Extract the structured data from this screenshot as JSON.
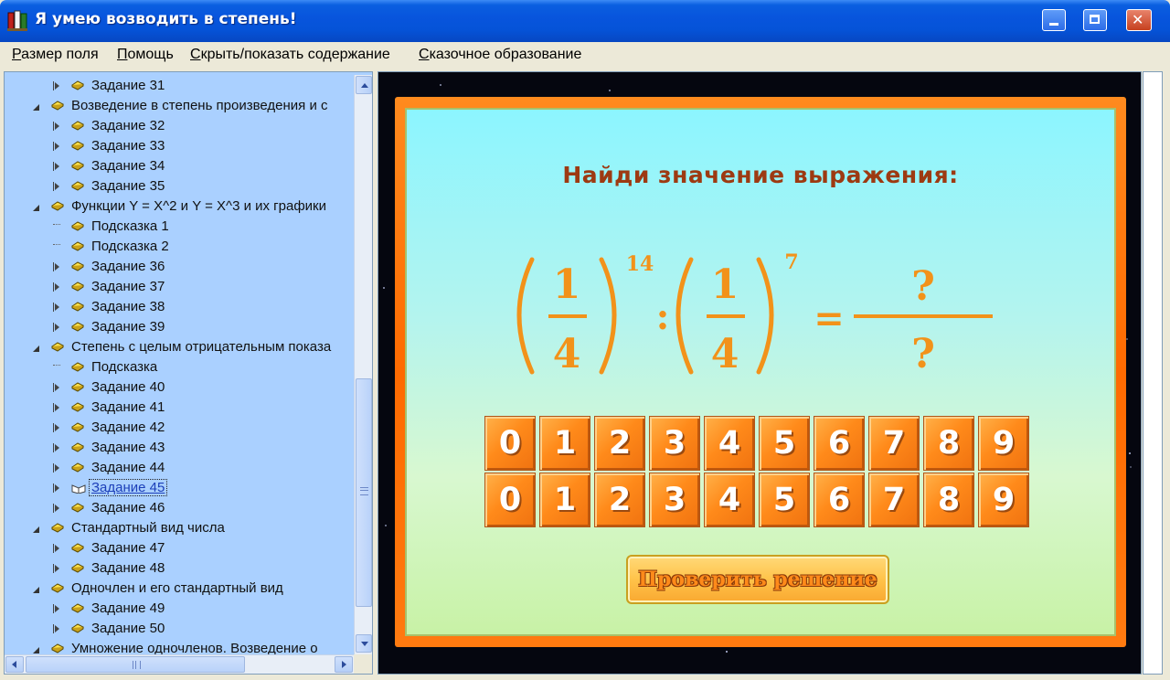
{
  "window": {
    "title": "Я умею возводить в степень!"
  },
  "menu": [
    {
      "before": "",
      "underline": "Р",
      "after": "азмер поля"
    },
    {
      "before": "",
      "underline": "П",
      "after": "омощь"
    },
    {
      "before": "",
      "underline": "С",
      "after": "крыть/показать содержание"
    },
    {
      "before": "",
      "underline": "С",
      "after": "казочное образование"
    }
  ],
  "tree": [
    {
      "level": 2,
      "expander": "closed",
      "label": "Задание 31"
    },
    {
      "level": 1,
      "expander": "open",
      "label": "Возведение в степень произведения и с"
    },
    {
      "level": 2,
      "expander": "closed",
      "label": "Задание 32"
    },
    {
      "level": 2,
      "expander": "closed",
      "label": "Задание 33"
    },
    {
      "level": 2,
      "expander": "closed",
      "label": "Задание 34"
    },
    {
      "level": 2,
      "expander": "closed",
      "label": "Задание 35"
    },
    {
      "level": 1,
      "expander": "open",
      "label": "Функции Y = X^2 и Y = X^3 и их графики"
    },
    {
      "level": 2,
      "expander": "none",
      "label": "Подсказка 1"
    },
    {
      "level": 2,
      "expander": "none",
      "label": "Подсказка 2"
    },
    {
      "level": 2,
      "expander": "closed",
      "label": "Задание 36"
    },
    {
      "level": 2,
      "expander": "closed",
      "label": "Задание 37"
    },
    {
      "level": 2,
      "expander": "closed",
      "label": "Задание 38"
    },
    {
      "level": 2,
      "expander": "closed",
      "label": "Задание 39"
    },
    {
      "level": 1,
      "expander": "open",
      "label": "Степень с целым отрицательным показа"
    },
    {
      "level": 2,
      "expander": "none",
      "label": "Подсказка"
    },
    {
      "level": 2,
      "expander": "closed",
      "label": "Задание 40"
    },
    {
      "level": 2,
      "expander": "closed",
      "label": "Задание 41"
    },
    {
      "level": 2,
      "expander": "closed",
      "label": "Задание 42"
    },
    {
      "level": 2,
      "expander": "closed",
      "label": "Задание 43"
    },
    {
      "level": 2,
      "expander": "closed",
      "label": "Задание 44"
    },
    {
      "level": 2,
      "expander": "closed",
      "label": "Задание 45",
      "selected": true
    },
    {
      "level": 2,
      "expander": "closed",
      "label": "Задание 46"
    },
    {
      "level": 1,
      "expander": "open",
      "label": "Стандартный вид числа"
    },
    {
      "level": 2,
      "expander": "closed",
      "label": "Задание 47"
    },
    {
      "level": 2,
      "expander": "closed",
      "label": "Задание 48"
    },
    {
      "level": 1,
      "expander": "open",
      "label": "Одночлен и его стандартный вид"
    },
    {
      "level": 2,
      "expander": "closed",
      "label": "Задание 49"
    },
    {
      "level": 2,
      "expander": "closed",
      "label": "Задание 50"
    },
    {
      "level": 1,
      "expander": "open",
      "label": "Умножение одночленов. Возведение о"
    }
  ],
  "task": {
    "title": "Найди значение выражения:",
    "numerator": "1",
    "denominator": "4",
    "exp1": "14",
    "exp2": "7",
    "divide": ":",
    "equals": "=",
    "answer_top": "?",
    "answer_bottom": "?"
  },
  "digit_rows": [
    [
      "0",
      "1",
      "2",
      "3",
      "4",
      "5",
      "6",
      "7",
      "8",
      "9"
    ],
    [
      "0",
      "1",
      "2",
      "3",
      "4",
      "5",
      "6",
      "7",
      "8",
      "9"
    ]
  ],
  "check_button": "Проверить решение",
  "colors": {
    "title_text": "#9d3a12",
    "math_orange": "#f2921a",
    "frame_orange": "#ff6a00",
    "tree_bg": "#aad0ff"
  }
}
